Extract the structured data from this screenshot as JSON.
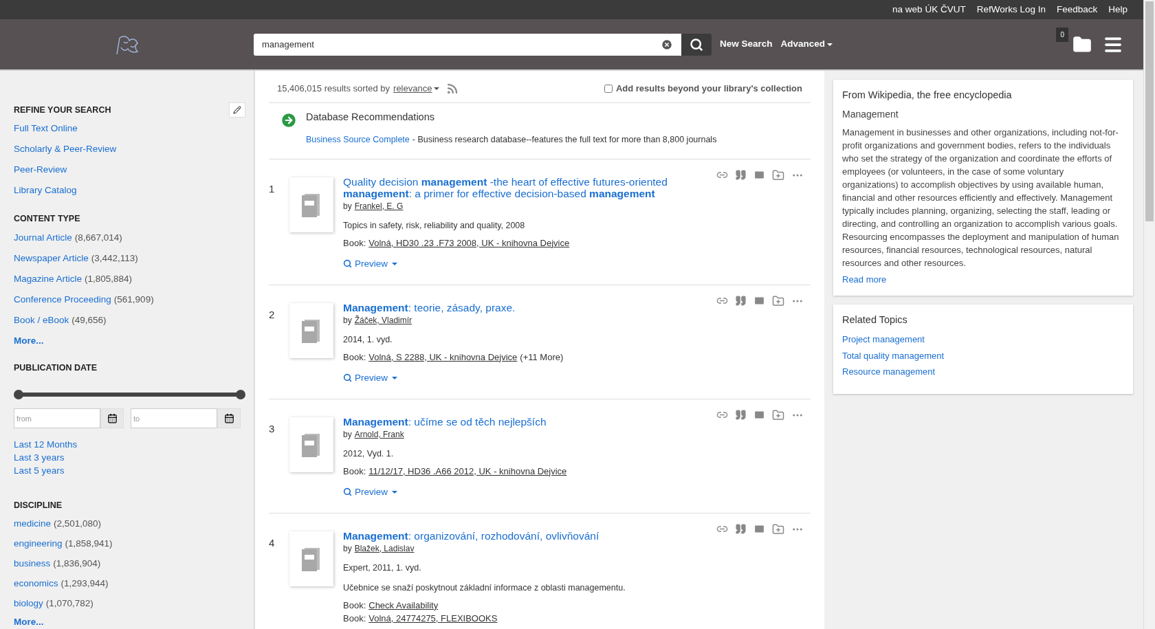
{
  "top_links": [
    "na web ÚK ČVUT",
    "RefWorks Log In",
    "Feedback",
    "Help"
  ],
  "search": {
    "value": "management",
    "new_search": "New Search",
    "advanced": "Advanced",
    "basket_count": "0"
  },
  "sidebar": {
    "refine_title": "REFINE YOUR SEARCH",
    "refine_items": [
      "Full Text Online",
      "Scholarly & Peer-Review",
      "Peer-Review",
      "Library Catalog"
    ],
    "content_type_title": "CONTENT TYPE",
    "content_types": [
      {
        "label": "Journal Article",
        "count": "(8,667,014)"
      },
      {
        "label": "Newspaper Article",
        "count": "(3,442,113)"
      },
      {
        "label": "Magazine Article",
        "count": "(1,805,884)"
      },
      {
        "label": "Conference Proceeding",
        "count": "(561,909)"
      },
      {
        "label": "Book / eBook",
        "count": "(49,656)"
      }
    ],
    "content_more": "More...",
    "date_title": "PUBLICATION DATE",
    "date_slider": {
      "level": 1
    },
    "from_placeholder": "from",
    "to_placeholder": "to",
    "date_presets": [
      "Last 12 Months",
      "Last 3 years",
      "Last 5 years"
    ],
    "discipline_title": "DISCIPLINE",
    "disciplines": [
      {
        "label": "medicine",
        "count": "(2,501,080)"
      },
      {
        "label": "engineering",
        "count": "(1,858,941)"
      },
      {
        "label": "business",
        "count": "(1,836,904)"
      },
      {
        "label": "economics",
        "count": "(1,293,944)"
      },
      {
        "label": "biology",
        "count": "(1,070,782)"
      }
    ],
    "discipline_more": "More..."
  },
  "results_header": {
    "count_text": "15,406,015 results sorted by",
    "sort": "relevance",
    "beyond_label": "Add results beyond your library's collection",
    "beyond_checked": false
  },
  "recommendation": {
    "title": "Database Recommendations",
    "link": "Business Source Complete",
    "text": "- Business research database--features the full text for more than 8,800 journals"
  },
  "results": [
    {
      "number": "1",
      "title": "Quality decision **management** -the heart of effective futures-oriented **management**: a primer for effective decision-based **management**",
      "author_prefix": "by",
      "author": "Frankel, E. G",
      "details": [
        "Topics in safety, risk, reliability and quality, 2008"
      ],
      "holdings": [
        {
          "label": "Book:",
          "link": "Volná, HD30 .23 .F73 2008, UK - knihovna Dejvice"
        }
      ],
      "preview": "Preview"
    },
    {
      "number": "2",
      "title": "**Management**: teorie, zásady, praxe.",
      "author_prefix": "by",
      "author": "Žáček, Vladimír",
      "details": [
        "2014, 1. vyd."
      ],
      "holdings": [
        {
          "label": "Book:",
          "link": "Volná, S 2288, UK - knihovna Dejvice",
          "extra": "(+11 More)"
        }
      ],
      "preview": "Preview"
    },
    {
      "number": "3",
      "title": "**Management**: učíme se od těch nejlepších",
      "author_prefix": "by",
      "author": "Arnold, Frank",
      "details": [
        "2012, Vyd. 1."
      ],
      "holdings": [
        {
          "label": "Book:",
          "link": "11/12/17, HD36 .A66 2012, UK - knihovna Dejvice"
        }
      ],
      "preview": "Preview"
    },
    {
      "number": "4",
      "title": "**Management**: organizování, rozhodování, ovlivňování",
      "author_prefix": "by",
      "author": "Blažek, Ladislav",
      "details": [
        "Expert, 2011, 1. vyd.",
        "Učebnice se snaží poskytnout základní informace z oblasti managementu."
      ],
      "holdings": [
        {
          "label": "Book:",
          "link": "Check Availability"
        },
        {
          "label": "Book:",
          "link": "Volná, 24774275, FLEXIBOOKS"
        }
      ]
    }
  ],
  "wikipedia": {
    "source": "From Wikipedia, the free encyclopedia",
    "title": "Management",
    "text": "Management in businesses and other organizations, including not-for-profit organizations and government bodies, refers to the individuals who set the strategy of the organization and coordinate the efforts of employees (or volunteers, in the case of some voluntary organizations) to accomplish objectives by using available human, financial and other resources efficiently and effectively. Management typically includes planning, organizing, selecting the staff, leading or directing, and controlling an organization to accomplish various goals. Resourcing encompasses the deployment and manipulation of human resources, financial resources, technological resources, natural resources and other resources.",
    "read_more": "Read more"
  },
  "related": {
    "title": "Related Topics",
    "items": [
      "Project management",
      "Total quality management",
      "Resource management"
    ]
  }
}
